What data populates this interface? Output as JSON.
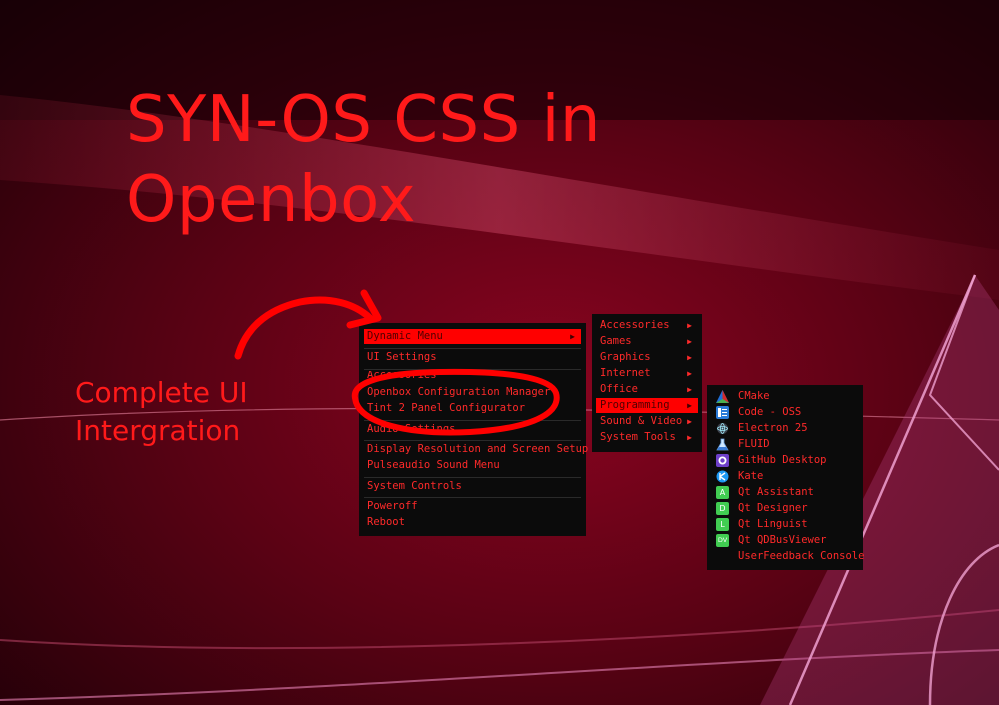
{
  "headline": {
    "line1": "SYN-OS CSS in",
    "line2": "Openbox"
  },
  "caption": {
    "line1": "Complete UI",
    "line2": "Intergration"
  },
  "main_menu": {
    "items": [
      {
        "label": "Dynamic Menu",
        "highlighted": true,
        "submenu": true
      },
      {
        "label": "UI Settings"
      },
      {
        "label": "Accessories"
      },
      {
        "label": "Openbox Configuration Manager"
      },
      {
        "label": "Tint 2 Panel Configurator"
      },
      {
        "label": "Audio Settings"
      },
      {
        "label": "Display Resolution and Screen Setup"
      },
      {
        "label": "Pulseaudio Sound Menu"
      },
      {
        "label": "System Controls"
      },
      {
        "label": "Poweroff"
      },
      {
        "label": "Reboot"
      }
    ]
  },
  "category_menu": {
    "items": [
      {
        "label": "Accessories",
        "submenu": true
      },
      {
        "label": "Games",
        "submenu": true
      },
      {
        "label": "Graphics",
        "submenu": true
      },
      {
        "label": "Internet",
        "submenu": true
      },
      {
        "label": "Office",
        "submenu": true
      },
      {
        "label": "Programming",
        "submenu": true,
        "highlighted": true
      },
      {
        "label": "Sound & Video",
        "submenu": true
      },
      {
        "label": "System Tools",
        "submenu": true
      }
    ]
  },
  "programming_menu": {
    "items": [
      {
        "label": "CMake",
        "icon": "cmake-icon"
      },
      {
        "label": "Code - OSS",
        "icon": "code-oss-icon"
      },
      {
        "label": "Electron 25",
        "icon": "electron-icon"
      },
      {
        "label": "FLUID",
        "icon": "fluid-flask-icon"
      },
      {
        "label": "GitHub Desktop",
        "icon": "github-icon"
      },
      {
        "label": "Kate",
        "icon": "kate-icon"
      },
      {
        "label": "Qt Assistant",
        "icon": "qt-assistant-icon",
        "glyph": "A"
      },
      {
        "label": "Qt Designer",
        "icon": "qt-designer-icon",
        "glyph": "D"
      },
      {
        "label": "Qt Linguist",
        "icon": "qt-linguist-icon",
        "glyph": "L"
      },
      {
        "label": "Qt QDBusViewer",
        "icon": "qt-dbusviewer-icon",
        "glyph": "DV"
      },
      {
        "label": "UserFeedback Console",
        "icon": ""
      }
    ]
  },
  "submenu_arrow": "▶",
  "colors": {
    "accent_red": "#ff1a1a",
    "menu_bg": "#0b0b0b",
    "highlight": "#ff0000",
    "annotation": "#ff0000"
  }
}
